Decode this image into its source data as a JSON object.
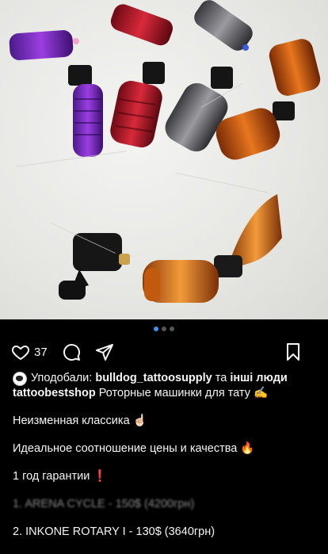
{
  "carousel": {
    "dots": 3,
    "active_index": 0
  },
  "actions": {
    "likes_count": "37",
    "icons": [
      "heart-icon",
      "comment-icon",
      "share-icon",
      "bookmark-icon"
    ]
  },
  "caption": {
    "liked_by_prefix": "Уподобали:",
    "liked_by_user": "bulldog_tattoosupply",
    "liked_by_mid": "та",
    "liked_by_others": "інші люди",
    "author": "tattoobestshop",
    "intro": "Роторные машинки для тату ✍️",
    "line1": "Неизменная классика ☝🏻",
    "line2": "Идеальное соотношение цены и качества 🔥",
    "line3": "1 год гарантии ❗️",
    "item1": "1. ARENA CYCLE - 150$ (4200грн)",
    "item2": "2. INKONE ROTARY I - 130$ (3640грн)"
  },
  "colors": {
    "accent": "#3897f0",
    "background": "#000000",
    "text": "#f5f5f5"
  }
}
